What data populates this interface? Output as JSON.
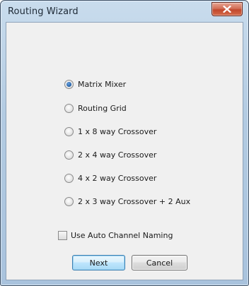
{
  "window": {
    "title": "Routing Wizard"
  },
  "options": [
    {
      "label": "Matrix Mixer",
      "selected": true
    },
    {
      "label": "Routing Grid",
      "selected": false
    },
    {
      "label": "1 x 8 way Crossover",
      "selected": false
    },
    {
      "label": "2 x 4 way Crossover",
      "selected": false
    },
    {
      "label": "4 x 2 way Crossover",
      "selected": false
    },
    {
      "label": "2 x 3 way Crossover + 2 Aux",
      "selected": false
    }
  ],
  "auto_naming": {
    "label": "Use Auto Channel Naming",
    "checked": false
  },
  "buttons": {
    "next": "Next",
    "cancel": "Cancel"
  },
  "colors": {
    "title_bar": "#b3cbe2",
    "close_button": "#c2482d",
    "dialog_background": "#f0f0f0",
    "radio_selected": "#1f5da6",
    "default_button_border": "#3c7fb1"
  },
  "icons": {
    "close": "close-icon"
  }
}
